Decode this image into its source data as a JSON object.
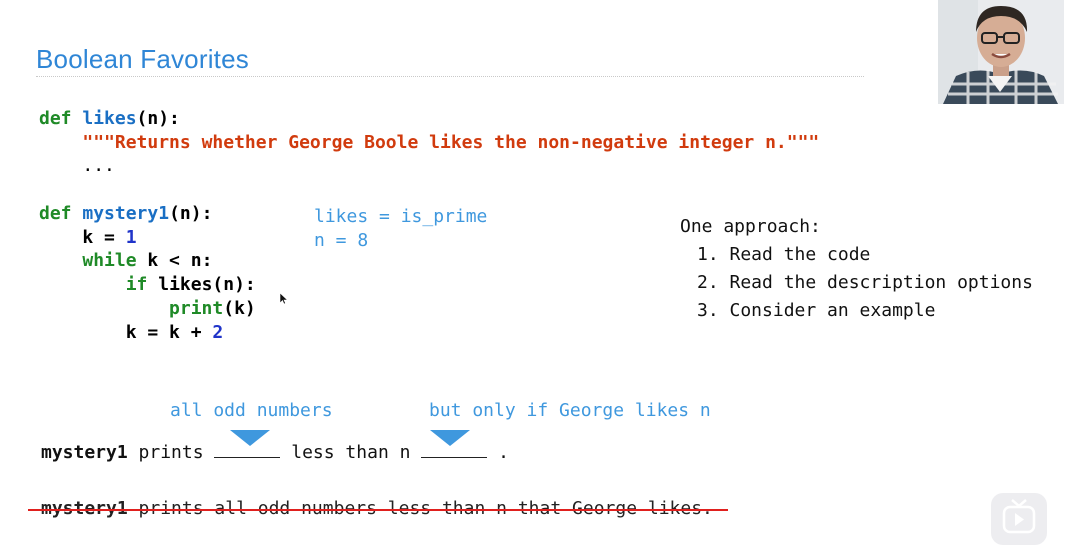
{
  "slide": {
    "title": "Boolean Favorites"
  },
  "code_likes": {
    "line1_def": "def",
    "line1_name": "likes",
    "line1_rest": "(n):",
    "line2_doc": "\"\"\"Returns whether George Boole likes the non-negative integer n.\"\"\"",
    "line3_ellipsis": "..."
  },
  "code_mystery": {
    "def": "def",
    "name": "mystery1",
    "sig": "(n):",
    "k_assign": "k = ",
    "k_init": "1",
    "while": "while",
    "while_cond": " k < n:",
    "if": "if",
    "if_cond": " likes(n):",
    "print": "print",
    "print_arg": "(k)",
    "k_update": "k = k + ",
    "k_step": "2"
  },
  "annotation": {
    "likes_line": "likes = is_prime",
    "n_line": "n = 8"
  },
  "approach": {
    "heading": "One approach:",
    "steps": [
      "1. Read the code",
      "2. Read the description options",
      "3. Consider an example"
    ]
  },
  "hints": {
    "first": "all odd numbers",
    "second": "but only if George likes n"
  },
  "sentence": {
    "subject": "mystery1",
    "prints": " prints ",
    "middle": " less than n ",
    "end": " ."
  },
  "struck_sentence": {
    "subject": "mystery1",
    "rest": " prints all odd numbers less than n that George likes."
  },
  "colors": {
    "title_blue": "#2f86d6",
    "hint_blue": "#3f98de",
    "keyword_green": "#1f8a27",
    "string_red": "#d13b0e",
    "number_blue": "#2034c9",
    "strike_red": "#e0201e"
  },
  "icons": {
    "webcam": "presenter-webcam",
    "cursor": "mouse-pointer-icon",
    "play": "play-icon"
  }
}
